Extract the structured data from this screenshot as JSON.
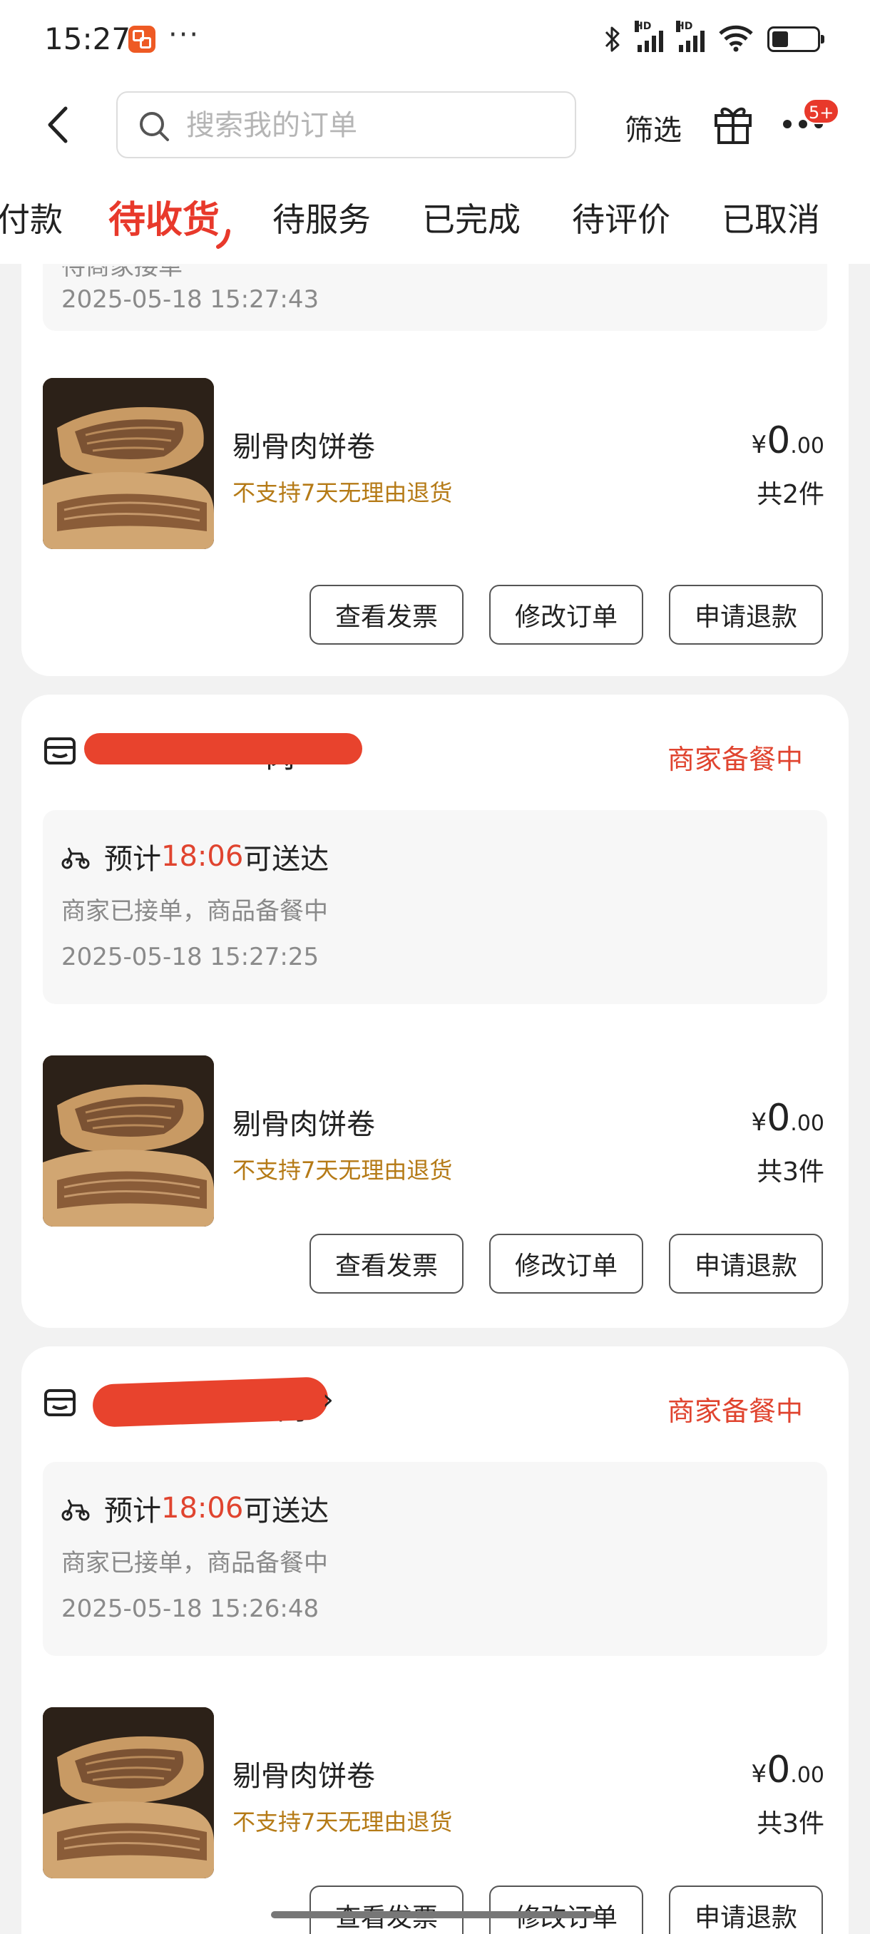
{
  "status_bar": {
    "time": "15:27",
    "dots": "···",
    "network_label": "HD",
    "icons": [
      "app-icon",
      "bluetooth-icon",
      "signal-icon",
      "wifi-icon",
      "battery-icon"
    ]
  },
  "header": {
    "search_placeholder": "搜索我的订单",
    "filter_label": "筛选",
    "more_badge": "5+"
  },
  "tabs": [
    {
      "label": "付款",
      "active": false
    },
    {
      "label": "待收货",
      "active": true
    },
    {
      "label": "待服务",
      "active": false
    },
    {
      "label": "已完成",
      "active": false
    },
    {
      "label": "待评价",
      "active": false
    },
    {
      "label": "已取消",
      "active": false
    }
  ],
  "colors": {
    "accent": "#e8392b",
    "status": "#e0442f",
    "warning_text": "#b57a16",
    "info_gray": "#8a8a8a"
  },
  "orders": [
    {
      "partial_status_line": "待商家接单",
      "timestamp": "2025-05-18 15:27:43",
      "product": {
        "name": "剔骨肉饼卷",
        "note": "不支持7天无理由退货",
        "price_currency": "¥",
        "price_int": "0",
        "price_dec": ".00",
        "quantity": "共2件"
      },
      "buttons": [
        "查看发票",
        "修改订单",
        "申请退款"
      ]
    },
    {
      "store_name_visible": "肉",
      "status": "商家备餐中",
      "eta_prefix": "预计",
      "eta_time": "18:06",
      "eta_suffix": "可送达",
      "info": "商家已接单，商品备餐中",
      "timestamp": "2025-05-18 15:27:25",
      "product": {
        "name": "剔骨肉饼卷",
        "note": "不支持7天无理由退货",
        "price_currency": "¥",
        "price_int": "0",
        "price_dec": ".00",
        "quantity": "共3件"
      },
      "buttons": [
        "查看发票",
        "修改订单",
        "申请退款"
      ]
    },
    {
      "store_name_visible": "卷肉",
      "store_chevron": "›",
      "status": "商家备餐中",
      "eta_prefix": "预计",
      "eta_time": "18:06",
      "eta_suffix": "可送达",
      "info": "商家已接单，商品备餐中",
      "timestamp": "2025-05-18 15:26:48",
      "product": {
        "name": "剔骨肉饼卷",
        "note": "不支持7天无理由退货",
        "price_currency": "¥",
        "price_int": "0",
        "price_dec": ".00",
        "quantity": "共3件"
      },
      "buttons": [
        "查看发票",
        "修改订单",
        "申请退款"
      ]
    }
  ]
}
